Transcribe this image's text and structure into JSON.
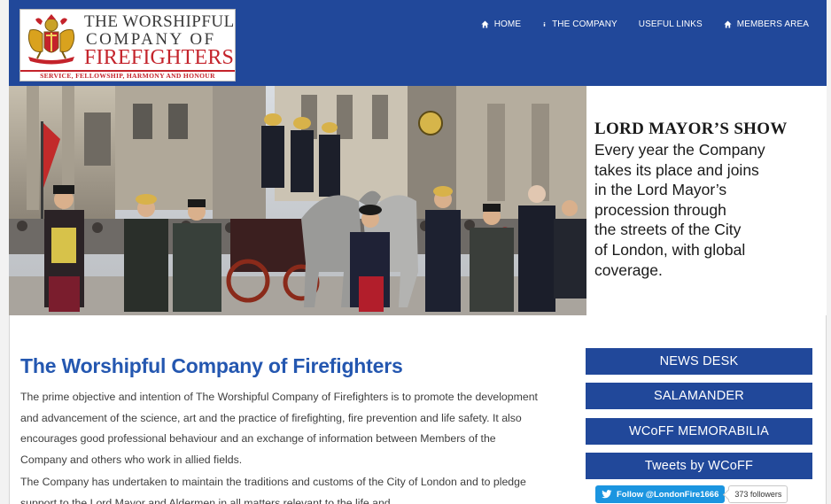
{
  "logo": {
    "line1": "THE WORSHIPFUL",
    "line2": "COMPANY OF",
    "line3": "FIREFIGHTERS",
    "motto": "SERVICE, FELLOWSHIP, HARMONY AND HONOUR"
  },
  "nav": {
    "items": [
      {
        "label": "HOME",
        "icon": "home-icon"
      },
      {
        "label": "THE COMPANY",
        "icon": "info-icon"
      },
      {
        "label": "USEFUL LINKS",
        "icon": ""
      },
      {
        "label": "MEMBERS AREA",
        "icon": "home-icon"
      }
    ]
  },
  "hero": {
    "title": "LORD MAYOR’S SHOW",
    "text": "Every year the Company\ntakes its place and joins\nin the Lord Mayor’s\nprocession through\nthe streets of the City\nof London, with global\ncoverage."
  },
  "main": {
    "title": "The Worshipful Company of Firefighters",
    "paragraph1": "The prime objective and intention of The Worshipful Company of Firefighters is to promote the development and advancement of the science, art and the practice of firefighting, fire prevention and life safety. It also encourages good professional behaviour and an exchange of information between Members of the Company and others who work in allied fields.",
    "paragraph2": "The Company has undertaken to maintain the traditions and customs of the City of London and to pledge support to the Lord Mayor and Aldermen in all matters relevant to the life and"
  },
  "sidebar": {
    "buttons": [
      "NEWS DESK",
      "SALAMANDER",
      "WCoFF MEMORABILIA",
      "Tweets by WCoFF"
    ],
    "follow_label": "Follow @LondonFire1666",
    "followers": "373 followers"
  },
  "colors": {
    "brand_blue": "#21489a",
    "title_blue": "#2457b0",
    "logo_red": "#c4232b",
    "twitter_blue": "#1b95e0"
  }
}
